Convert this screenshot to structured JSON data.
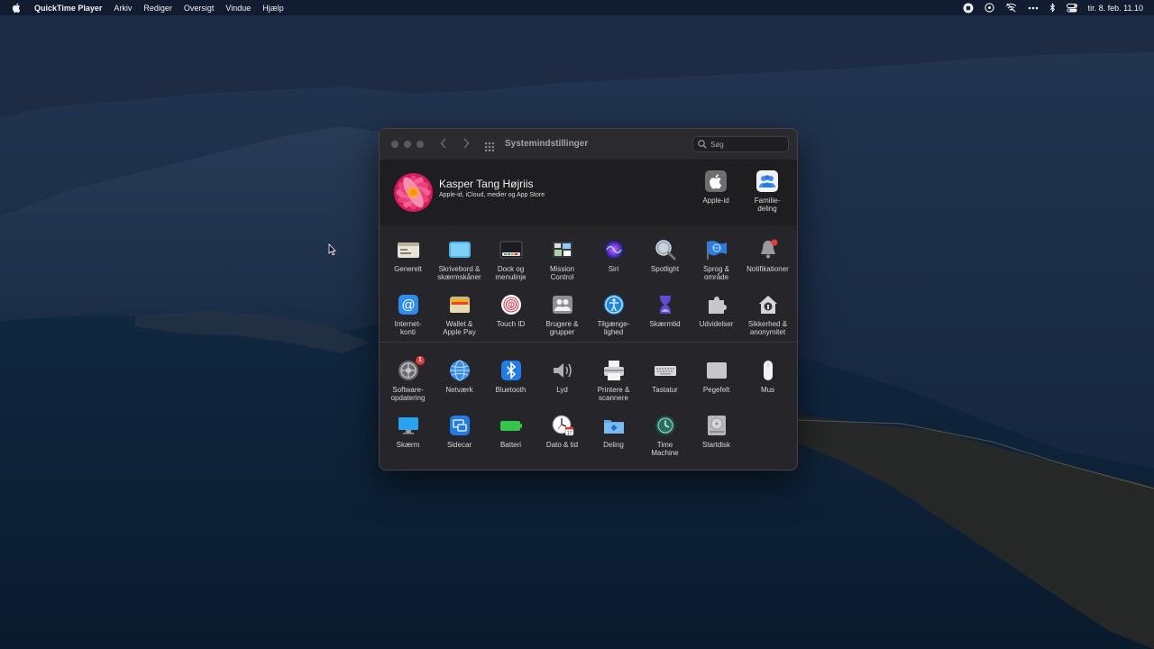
{
  "menubar": {
    "apple_icon": "apple-logo-icon",
    "app_name": "QuickTime Player",
    "menus": [
      "Arkiv",
      "Rediger",
      "Oversigt",
      "Vindue",
      "Hjælp"
    ],
    "status_icons": [
      "screen-recording-stop-icon",
      "play-circle-icon",
      "wifi-off-icon",
      "more-dots-icon",
      "bluetooth-icon",
      "control-center-icon"
    ],
    "clock": "tir. 8. feb.  11.10"
  },
  "window": {
    "title": "Systemindstillinger",
    "search_placeholder": "Søg"
  },
  "user": {
    "name": "Kasper Tang Højriis",
    "subtitle": "Apple-id, iCloud, medier og App Store",
    "shortcuts": [
      {
        "label": "Apple-id",
        "icon": "apple-id-icon"
      },
      {
        "label": "Familie-\ndeling",
        "icon": "family-sharing-icon"
      }
    ]
  },
  "prefs": {
    "row1": [
      {
        "label": "Generelt",
        "icon": "general-icon"
      },
      {
        "label": "Skrivebord &\nskærmskåner",
        "icon": "desktop-screensaver-icon"
      },
      {
        "label": "Dock og\nmenulinje",
        "icon": "dock-icon"
      },
      {
        "label": "Mission\nControl",
        "icon": "mission-control-icon"
      },
      {
        "label": "Siri",
        "icon": "siri-icon"
      },
      {
        "label": "Spotlight",
        "icon": "spotlight-icon"
      },
      {
        "label": "Sprog &\nområde",
        "icon": "language-region-icon"
      },
      {
        "label": "Notifikationer",
        "icon": "notifications-icon"
      }
    ],
    "row2": [
      {
        "label": "Internet-\nkonti",
        "icon": "internet-accounts-icon"
      },
      {
        "label": "Wallet &\nApple Pay",
        "icon": "wallet-icon"
      },
      {
        "label": "Touch ID",
        "icon": "touch-id-icon"
      },
      {
        "label": "Brugere &\ngrupper",
        "icon": "users-groups-icon"
      },
      {
        "label": "Tilgænge-\nlighed",
        "icon": "accessibility-icon"
      },
      {
        "label": "Skærmtid",
        "icon": "screen-time-icon"
      },
      {
        "label": "Udvidelser",
        "icon": "extensions-icon"
      },
      {
        "label": "Sikkerhed &\nanonymitet",
        "icon": "security-privacy-icon"
      }
    ],
    "row3": [
      {
        "label": "Software-\nopdatering",
        "icon": "software-update-icon",
        "badge": "1"
      },
      {
        "label": "Netværk",
        "icon": "network-icon"
      },
      {
        "label": "Bluetooth",
        "icon": "bluetooth-pref-icon"
      },
      {
        "label": "Lyd",
        "icon": "sound-icon"
      },
      {
        "label": "Printere &\nscannere",
        "icon": "printer-icon"
      },
      {
        "label": "Tastatur",
        "icon": "keyboard-icon"
      },
      {
        "label": "Pegefelt",
        "icon": "trackpad-icon"
      },
      {
        "label": "Mus",
        "icon": "mouse-icon"
      }
    ],
    "row4": [
      {
        "label": "Skærm",
        "icon": "display-icon"
      },
      {
        "label": "Sidecar",
        "icon": "sidecar-icon"
      },
      {
        "label": "Batteri",
        "icon": "battery-icon"
      },
      {
        "label": "Dato & tid",
        "icon": "date-time-icon"
      },
      {
        "label": "Deling",
        "icon": "sharing-icon"
      },
      {
        "label": "Time\nMachine",
        "icon": "time-machine-icon"
      },
      {
        "label": "Startdisk",
        "icon": "startup-disk-icon"
      }
    ]
  }
}
